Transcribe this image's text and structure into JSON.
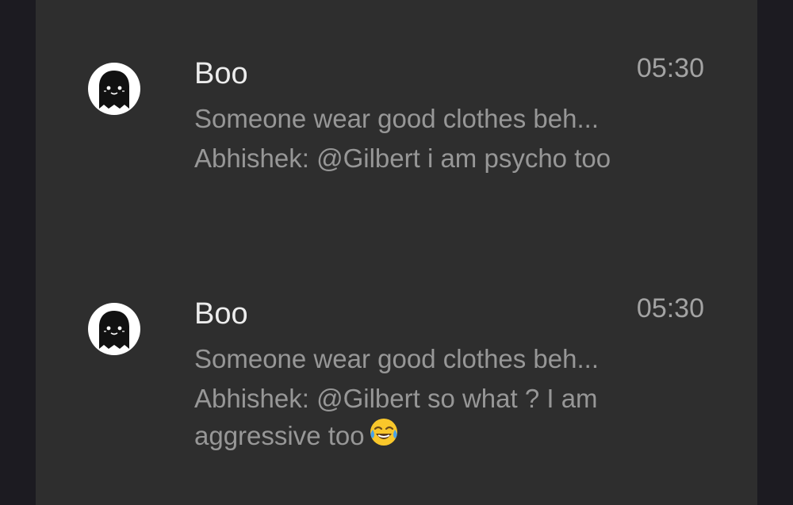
{
  "notifications": [
    {
      "sender": "Boo",
      "time": "05:30",
      "group_preview": "Someone wear good clothes beh...",
      "message": "Abhishek: @Gilbert i am psycho too",
      "emoji": ""
    },
    {
      "sender": "Boo",
      "time": "05:30",
      "group_preview": "Someone wear good clothes beh...",
      "message": "Abhishek: @Gilbert so what ? I am aggressive  too",
      "emoji": "face-with-tears-of-joy"
    }
  ],
  "colors": {
    "background": "#1c1b21",
    "panel": "#2e2e2e",
    "sender_text": "#ececec",
    "secondary_text": "#979797",
    "time_text": "#a3a3a3"
  },
  "icons": {
    "avatar": "ghost-icon"
  }
}
